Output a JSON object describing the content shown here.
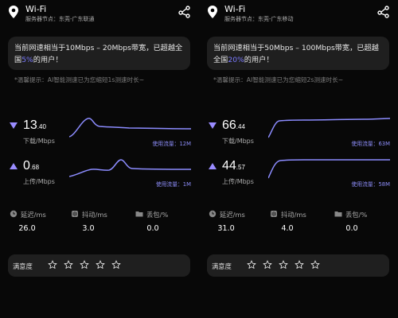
{
  "panels": [
    {
      "title": "Wi-Fi",
      "server": "服务器节点：东莞-广东联通",
      "info_prefix": "当前网速相当于10Mbps – 20Mbps带宽，已超越全国",
      "info_pct": "5%",
      "info_suffix": "的用户！",
      "tip": "*温馨提示：AI智能测速已为您缩短1s测速时长~",
      "download": {
        "main": "13",
        "frac": ".40",
        "label": "下载/Mbps",
        "usage": "使用流量：12M"
      },
      "upload": {
        "main": "0",
        "frac": ".68",
        "label": "上传/Mbps",
        "usage": "使用流量：1M"
      },
      "latency": {
        "label": "延迟/ms",
        "value": "26.0"
      },
      "jitter": {
        "label": "抖动/ms",
        "value": "3.0"
      },
      "loss": {
        "label": "丢包/%",
        "value": "0.0"
      },
      "rating_label": "满意度",
      "rating": 0
    },
    {
      "title": "Wi-Fi",
      "server": "服务器节点：东莞-广东移动",
      "info_prefix": "当前网速相当于50Mbps – 100Mbps带宽，已超越全国",
      "info_pct": "20%",
      "info_suffix": "的用户！",
      "tip": "*温馨提示：AI智能测速已为您缩短2s测速时长~",
      "download": {
        "main": "66",
        "frac": ".44",
        "label": "下载/Mbps",
        "usage": "使用流量：63M"
      },
      "upload": {
        "main": "44",
        "frac": ".57",
        "label": "上传/Mbps",
        "usage": "使用流量：58M"
      },
      "latency": {
        "label": "延迟/ms",
        "value": "31.0"
      },
      "jitter": {
        "label": "抖动/ms",
        "value": "4.0"
      },
      "loss": {
        "label": "丢包/%",
        "value": "0.0"
      },
      "rating_label": "满意度",
      "rating": 0
    }
  ],
  "colors": {
    "accent": "#7b7bff",
    "spark_line": "#8c8cff",
    "card_bg": "#1f1f1f"
  },
  "icons": {
    "location": "location-pin-icon",
    "share": "share-icon",
    "download": "triangle-down-icon",
    "upload": "triangle-up-icon",
    "latency": "clock-icon",
    "jitter": "jitter-icon",
    "loss": "folder-icon",
    "rating": "star-outline-icon"
  }
}
